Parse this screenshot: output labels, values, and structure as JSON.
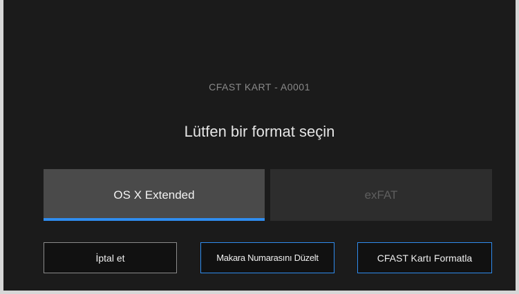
{
  "dialog": {
    "card_label": "CFAST KART - A0001",
    "prompt": "Lütfen bir format seçin"
  },
  "formats": {
    "selected": "OS X Extended",
    "options": [
      {
        "label": "OS X Extended",
        "state": "selected"
      },
      {
        "label": "exFAT",
        "state": "unselected"
      }
    ]
  },
  "buttons": {
    "cancel_label": "İptal et",
    "edit_reel_label": "Makara Numarasını Düzelt",
    "format_label": "CFAST Kartı Formatla"
  },
  "colors": {
    "accent": "#2f8df0",
    "background": "#1b1b1b",
    "selected_option_bg": "#4a4a4a",
    "unselected_option_bg": "#2d2d2d"
  }
}
